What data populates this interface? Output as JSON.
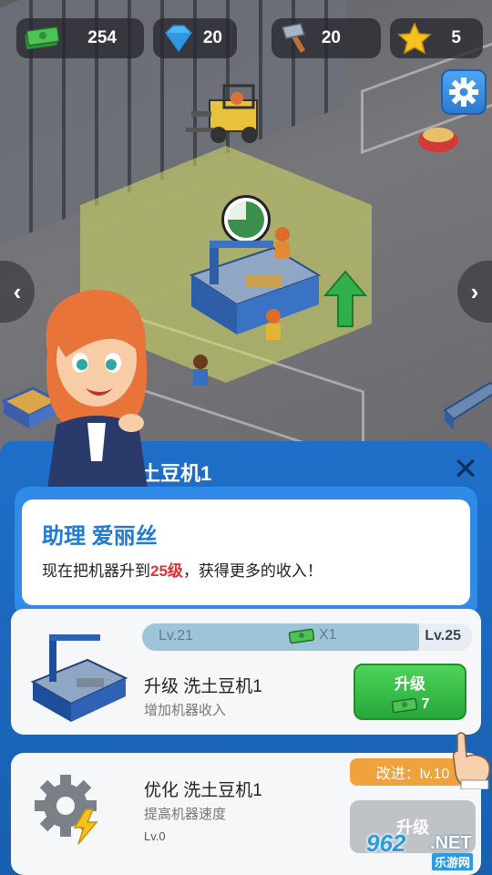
{
  "resources": [
    {
      "name": "cash",
      "icon": "cash-icon",
      "value": "254"
    },
    {
      "name": "gems",
      "icon": "diamond-icon",
      "value": "20"
    },
    {
      "name": "hammers",
      "icon": "hammer-icon",
      "value": "20"
    },
    {
      "name": "stars",
      "icon": "star-icon",
      "value": "5"
    }
  ],
  "production_progress": 0.75,
  "panel": {
    "title": "洗土豆机1"
  },
  "dialog": {
    "speaker": "助理 爱丽丝",
    "text_before": "现在把机器升到",
    "highlight": "25级",
    "text_after": "，获得更多的收入！"
  },
  "upgrade_card": {
    "level_from": "Lv.21",
    "level_to": "Lv.25",
    "multiplier": "X1",
    "title": "升级 洗土豆机1",
    "subtitle": "增加机器收入",
    "button_label": "升级",
    "cost": "7"
  },
  "optimize_card": {
    "title": "优化 洗土豆机1",
    "subtitle": "提高机器速度",
    "level": "Lv.0",
    "badge": "改进：lv.10",
    "button_label": "升级"
  },
  "watermark": {
    "number": "962",
    "domain": ".NET",
    "site": "乐游网"
  },
  "colors": {
    "panel_blue": "#1e6fc9",
    "upgrade_green": "#27a83a",
    "badge_orange": "#f0a33c",
    "highlight_red": "#e63030"
  }
}
